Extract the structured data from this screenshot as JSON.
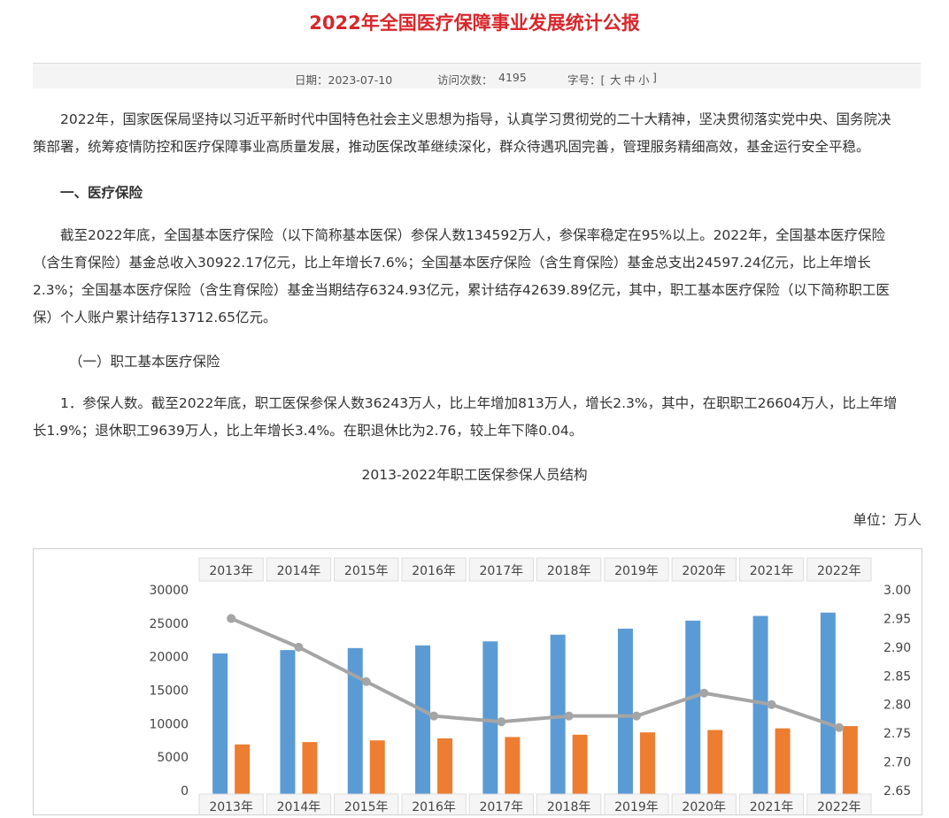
{
  "article": {
    "title": "2022年全国医疗保障事业发展统计公报",
    "meta": {
      "date_label": "日期：2023-07-10",
      "visits_label": "访问次数：",
      "visits_value": "4195",
      "font_label": "字号：[",
      "font_large": "大",
      "font_medium": "中",
      "font_small": "小",
      "font_close": "]"
    },
    "intro_line1": "2022年，国家医保局坚持以习近平新时代中国特色社会主义思想为指导，认真学习贯彻党的二十大精神，坚决贯彻落实党中央、国务院决",
    "intro_line2": "策部署，统筹疫情防控和医疗保障事业高质量发展，推动医保改革继续深化，群众待遇巩固完善，管理服务精细高效，基金运行安全平稳。",
    "section1_heading": "一、医疗保险",
    "section1_para": [
      "截至2022年底，全国基本医疗保险（以下简称基本医保）参保人数134592万人，参保率稳定在95%以上。2022年，全国基本医疗保险",
      "（含生育保险）基金总收入30922.17亿元，比上年增长7.6%；全国基本医疗保险（含生育保险）基金总支出24597.24亿元，比上年增长",
      "2.3%；全国基本医疗保险（含生育保险）基金当期结存6324.93亿元，累计结存42639.89亿元，其中，职工基本医疗保险（以下简称职工医",
      "保）个人账户累计结存13712.65亿元。"
    ],
    "subsection_heading": "（一）职工基本医疗保险",
    "item1_para": [
      "1．参保人数。截至2022年底，职工医保参保人数36243万人，比上年增加813万人，增长2.3%，其中，在职职工26604万人，比上年增",
      "长1.9%；退休职工9639万人，比上年增长3.4%。在职退休比为2.76，较上年下降0.04。"
    ],
    "chart_caption": "2013-2022年职工医保参保人员结构",
    "unit_label": "单位：万人"
  },
  "chart_data": {
    "type": "bar",
    "categories": [
      "2013年",
      "2014年",
      "2015年",
      "2016年",
      "2017年",
      "2018年",
      "2019年",
      "2020年",
      "2021年",
      "2022年"
    ],
    "series": [
      {
        "kind": "bar",
        "color": "#5b9bd5",
        "values": [
          20500,
          21000,
          21300,
          21700,
          22300,
          23300,
          24200,
          25400,
          26100,
          26600
        ]
      },
      {
        "kind": "bar",
        "color": "#ed7d31",
        "values": [
          6900,
          7250,
          7500,
          7800,
          8000,
          8350,
          8700,
          9050,
          9300,
          9639
        ]
      },
      {
        "kind": "line",
        "axis": "right",
        "color": "#a5a5a5",
        "values": [
          2.95,
          2.9,
          2.84,
          2.78,
          2.77,
          2.78,
          2.78,
          2.82,
          2.8,
          2.76
        ]
      }
    ],
    "left_axis": {
      "ticks": [
        "0",
        "5000",
        "10000",
        "15000",
        "20000",
        "25000",
        "30000"
      ],
      "ylim": [
        0,
        30000
      ]
    },
    "right_axis": {
      "ticks": [
        "2.65",
        "2.70",
        "2.75",
        "2.80",
        "2.85",
        "2.90",
        "2.95",
        "3.00"
      ],
      "ylim": [
        2.65,
        3.0
      ]
    },
    "grid": false
  }
}
